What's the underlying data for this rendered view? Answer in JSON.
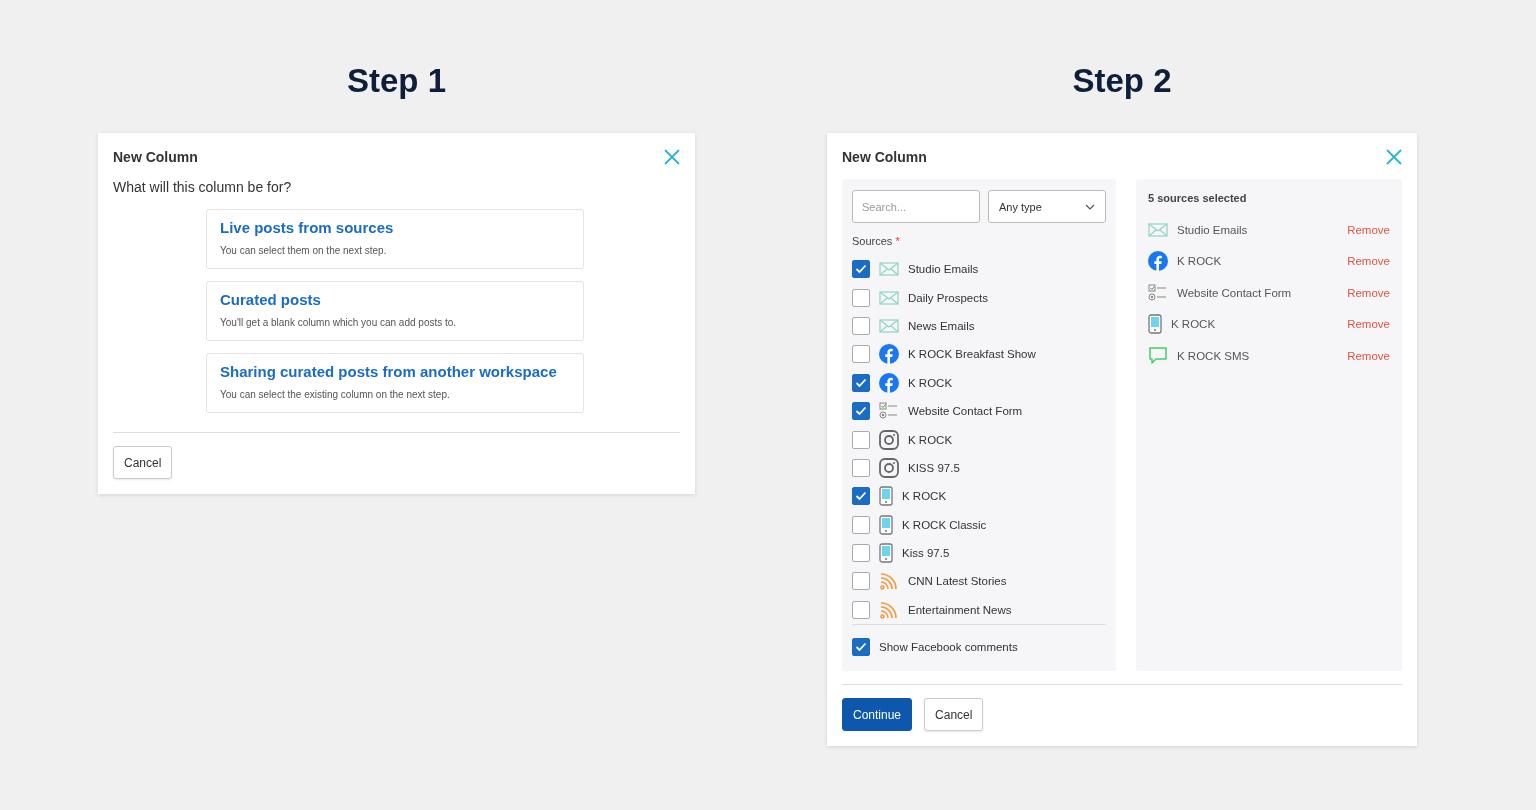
{
  "steps": [
    {
      "heading": "Step 1",
      "dialog": {
        "title": "New Column",
        "question": "What will this column be for?",
        "options": [
          {
            "title": "Live posts from sources",
            "description": "You can select them on the next step."
          },
          {
            "title": "Curated posts",
            "description": "You'll get a blank column which you can add posts to."
          },
          {
            "title": "Sharing curated posts from another workspace",
            "description": "You can select the existing column on the next step."
          }
        ],
        "buttons": [
          {
            "label": "Cancel",
            "kind": "secondary"
          }
        ]
      }
    },
    {
      "heading": "Step 2",
      "dialog": {
        "title": "New Column",
        "search": {
          "placeholder": "Search..."
        },
        "type_select": {
          "value": "Any type"
        },
        "sources_label": "Sources",
        "required_mark": "*",
        "sources": [
          {
            "name": "Studio Emails",
            "kind": "email",
            "checked": true
          },
          {
            "name": "Daily Prospects",
            "kind": "email",
            "checked": false
          },
          {
            "name": "News Emails",
            "kind": "email",
            "checked": false
          },
          {
            "name": "K ROCK Breakfast Show",
            "kind": "facebook",
            "checked": false
          },
          {
            "name": "K ROCK",
            "kind": "facebook",
            "checked": true
          },
          {
            "name": "Website Contact Form",
            "kind": "form",
            "checked": true
          },
          {
            "name": "K ROCK",
            "kind": "instagram",
            "checked": false
          },
          {
            "name": "KISS 97.5",
            "kind": "instagram",
            "checked": false
          },
          {
            "name": "K ROCK",
            "kind": "phone",
            "checked": true
          },
          {
            "name": "K ROCK Classic",
            "kind": "phone",
            "checked": false
          },
          {
            "name": "Kiss 97.5",
            "kind": "phone",
            "checked": false
          },
          {
            "name": "CNN Latest Stories",
            "kind": "rss",
            "checked": false
          },
          {
            "name": "Entertainment News",
            "kind": "rss",
            "checked": false
          }
        ],
        "show_comments": {
          "label": "Show Facebook comments",
          "checked": true
        },
        "selected_title": "5 sources selected",
        "selected": [
          {
            "name": "Studio Emails",
            "kind": "email",
            "action": "Remove"
          },
          {
            "name": "K ROCK",
            "kind": "facebook",
            "action": "Remove"
          },
          {
            "name": "Website Contact Form",
            "kind": "form",
            "action": "Remove"
          },
          {
            "name": "K ROCK",
            "kind": "phone",
            "action": "Remove"
          },
          {
            "name": "K ROCK SMS",
            "kind": "sms",
            "action": "Remove"
          }
        ],
        "buttons": [
          {
            "label": "Continue",
            "kind": "primary"
          },
          {
            "label": "Cancel",
            "kind": "secondary"
          }
        ]
      }
    }
  ]
}
